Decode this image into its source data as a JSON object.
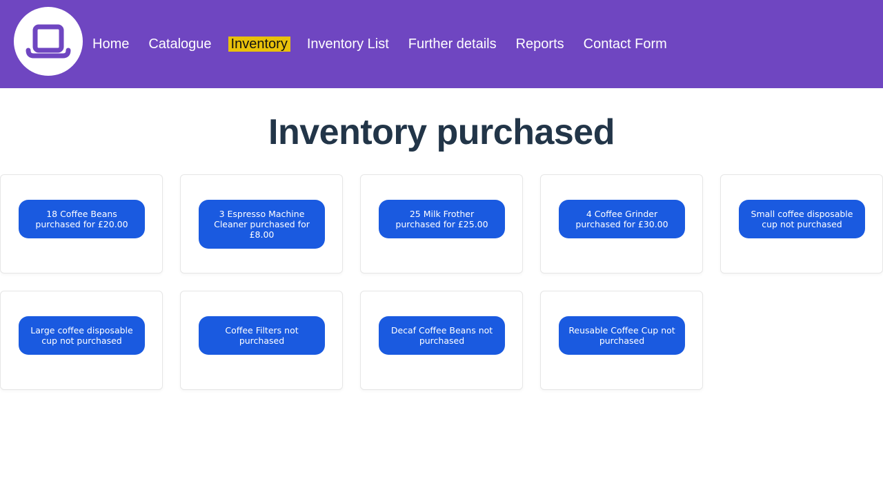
{
  "header": {
    "nav": [
      "Home",
      "Catalogue",
      "Inventory",
      "Inventory List",
      "Further details",
      "Reports",
      "Contact Form"
    ],
    "active_nav": "Inventory",
    "brand_color": "#6f46c1",
    "active_highlight_color": "#e9c10a",
    "logo_icon": "top-hat-icon"
  },
  "main": {
    "title": "Inventory purchased",
    "button_color": "#1a5ae0",
    "items": [
      "18 Coffee Beans purchased for £20.00",
      "3 Espresso Machine Cleaner purchased for £8.00",
      "25 Milk Frother purchased for £25.00",
      "4 Coffee Grinder purchased for £30.00",
      "Small coffee disposable cup not purchased",
      "Large coffee disposable cup not purchased",
      "Coffee Filters not purchased",
      "Decaf Coffee Beans not purchased",
      "Reusable Coffee Cup not purchased"
    ]
  }
}
